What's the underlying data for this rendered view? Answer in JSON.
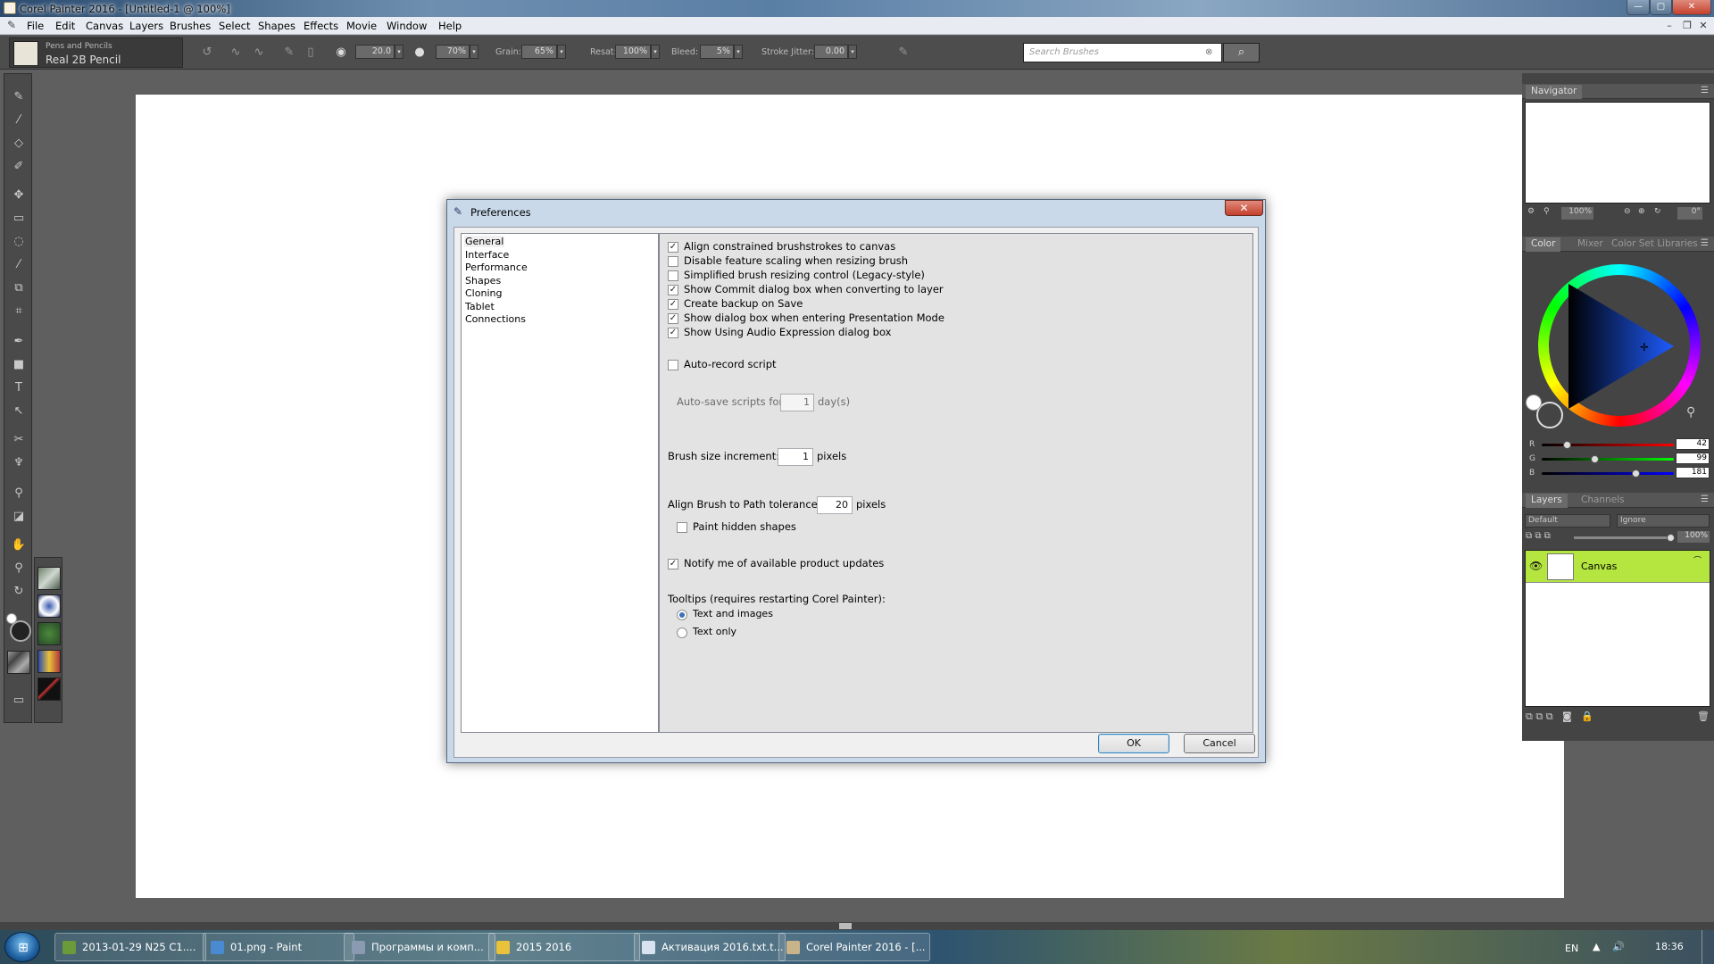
{
  "window": {
    "title": "Corel Painter 2016 - [Untitled-1 @ 100%]"
  },
  "menu": [
    "File",
    "Edit",
    "Canvas",
    "Layers",
    "Brushes",
    "Select",
    "Shapes",
    "Effects",
    "Movie",
    "Window",
    "Help"
  ],
  "propbar": {
    "brush_category": "Pens and Pencils",
    "brush_name": "Real 2B Pencil",
    "size_value": "20.0",
    "opacity_value": "70%",
    "grain_label": "Grain:",
    "grain_value": "65%",
    "resat_label": "Resat:",
    "resat_value": "100%",
    "bleed_label": "Bleed:",
    "bleed_value": "5%",
    "jitter_label": "Stroke Jitter:",
    "jitter_value": "0.00",
    "search_placeholder": "Search Brushes"
  },
  "navigator": {
    "title": "Navigator",
    "zoom": "100%",
    "rotation": "0°"
  },
  "color_panel": {
    "tabs": [
      "Color",
      "Mixer",
      "Color Set Libraries"
    ],
    "r_label": "R",
    "r_value": "42",
    "g_label": "G",
    "g_value": "99",
    "b_label": "B",
    "b_value": "181",
    "current_color": "#2a63b5"
  },
  "layers_panel": {
    "tabs": [
      "Layers",
      "Channels"
    ],
    "composite_method": "Default",
    "preserve": "Ignore",
    "opacity": "100%",
    "layer_name": "Canvas",
    "layer_color": "#b5e63f"
  },
  "dialog": {
    "title": "Preferences",
    "categories": [
      "General",
      "Interface",
      "Performance",
      "Shapes",
      "Cloning",
      "Tablet",
      "Connections"
    ],
    "checks": [
      {
        "label": "Align constrained brushstrokes to canvas",
        "checked": true
      },
      {
        "label": "Disable feature scaling when resizing brush",
        "checked": false
      },
      {
        "label": "Simplified brush resizing control (Legacy-style)",
        "checked": false
      },
      {
        "label": "Show Commit dialog box when converting to layer",
        "checked": true
      },
      {
        "label": "Create backup on Save",
        "checked": true
      },
      {
        "label": "Show dialog box when entering Presentation Mode",
        "checked": true
      },
      {
        "label": "Show Using Audio Expression dialog box",
        "checked": true
      }
    ],
    "auto_record": {
      "label": "Auto-record script",
      "checked": false
    },
    "auto_save": {
      "label": "Auto-save scripts for:",
      "value": "1",
      "unit": "day(s)"
    },
    "brush_increment": {
      "label": "Brush size increment:",
      "value": "1",
      "unit": "pixels"
    },
    "path_tolerance": {
      "label": "Align Brush to Path tolerance:",
      "value": "20",
      "unit": "pixels"
    },
    "paint_hidden": {
      "label": "Paint hidden shapes",
      "checked": false
    },
    "notify": {
      "label": "Notify me of available product updates",
      "checked": true
    },
    "tooltips": {
      "label": "Tooltips (requires restarting Corel Painter):",
      "options": [
        "Text and images",
        "Text only"
      ],
      "selected": 0
    },
    "ok_label": "OK",
    "cancel_label": "Cancel"
  },
  "taskbar": {
    "items": [
      {
        "label": "2013-01-29 N25 C1....",
        "color": "#6a9a3a"
      },
      {
        "label": "01.png - Paint",
        "color": "#4a8ad0"
      },
      {
        "label": "Программы и комп...",
        "color": "#8a9ab0"
      },
      {
        "label": "2015 2016",
        "color": "#e8c23a"
      },
      {
        "label": "Активация 2016.txt.t...",
        "color": "#d8e2f0"
      },
      {
        "label": "Corel Painter 2016 - [...",
        "color": "#c8b48a"
      }
    ],
    "lang": "EN",
    "time": "18:36"
  }
}
